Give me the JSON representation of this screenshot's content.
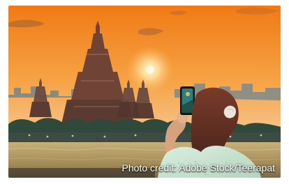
{
  "photo": {
    "credit_text": "Photo credit: Adobe Stock/Teerapat",
    "palette": {
      "sky_top": "#f28a1e",
      "sky_mid": "#f6a84a",
      "sky_bottom": "#f4c38c",
      "sun": "#fff2c5",
      "temple": "#7a4a3a",
      "temple_dark": "#4a2e2a",
      "city": "#5a6a6a",
      "trees": "#2f4a3a",
      "river": "#b9a56a",
      "river_dark": "#6f6b52",
      "hair": "#5b2f22",
      "skin": "#e3b38e",
      "blouse": "#cfe6d3",
      "phone": "#1d1d1f",
      "screen": "#3c8a8a"
    },
    "icons": [
      "phone-icon"
    ]
  }
}
